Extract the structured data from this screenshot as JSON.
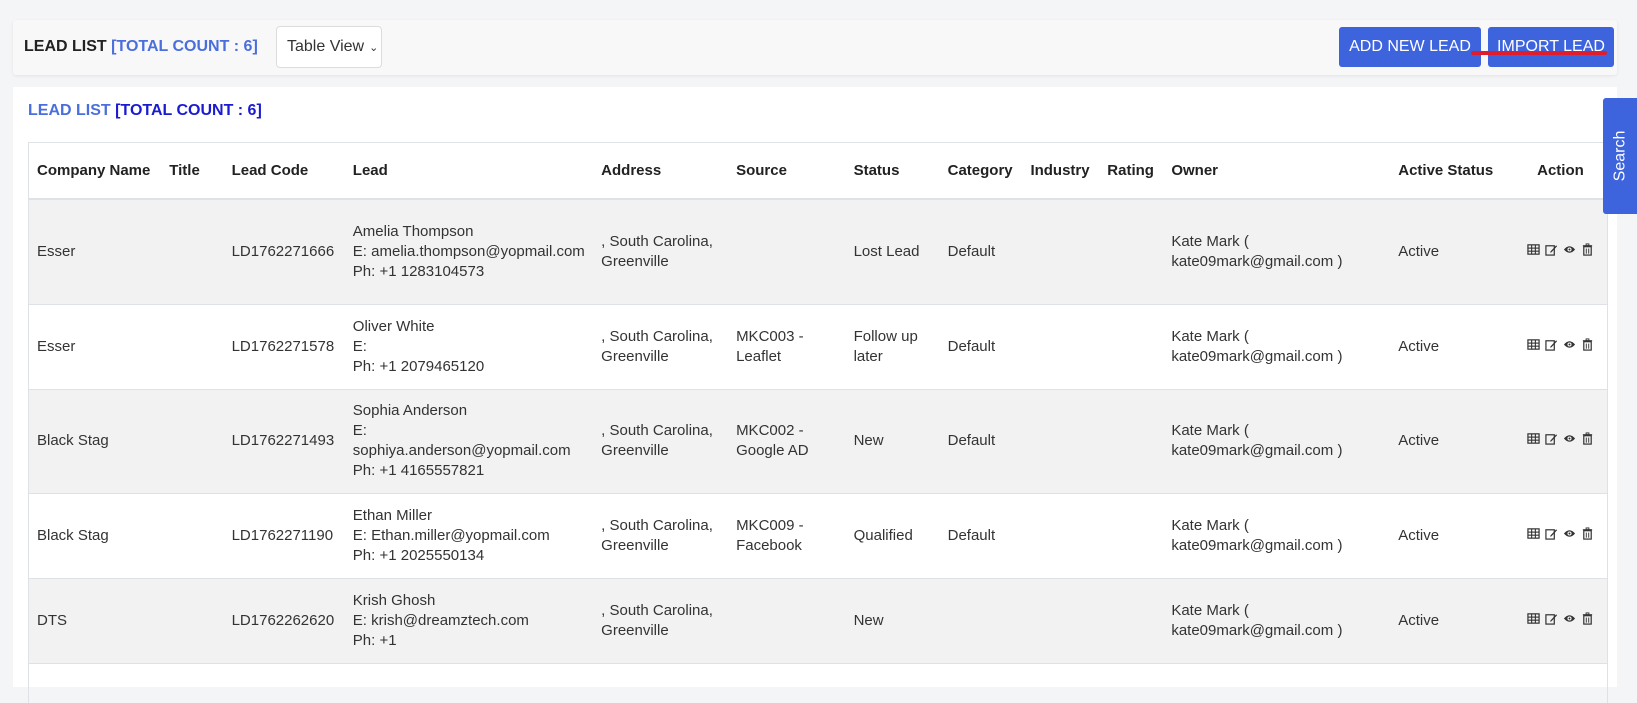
{
  "header": {
    "title": "LEAD LIST",
    "count_label": "[TOTAL COUNT : 6]",
    "view_selector": "Table View",
    "add_button": "ADD NEW LEAD",
    "import_button": "IMPORT LEAD"
  },
  "panel": {
    "title": "LEAD LIST",
    "count_label": "[TOTAL COUNT : 6]"
  },
  "search_tab": "Search",
  "table": {
    "columns": [
      "Company Name",
      "Title",
      "Lead Code",
      "Lead",
      "Address",
      "Source",
      "Status",
      "Category",
      "Industry",
      "Rating",
      "Owner",
      "Active Status",
      "Action"
    ],
    "rows": [
      {
        "company": "Esser",
        "title": "",
        "code": "LD1762271666",
        "lead_name": "Amelia Thompson",
        "lead_email": "E: amelia.thompson@yopmail.com",
        "lead_phone": "Ph: +1 1283104573",
        "address": ", South Carolina, Greenville",
        "source": "",
        "status": "Lost Lead",
        "category": "Default",
        "industry": "",
        "rating": "",
        "owner": "Kate Mark ( kate09mark@gmail.com )",
        "active": "Active"
      },
      {
        "company": "Esser",
        "title": "",
        "code": "LD1762271578",
        "lead_name": "Oliver White",
        "lead_email": "E:",
        "lead_phone": "Ph: +1 2079465120",
        "address": ", South Carolina, Greenville",
        "source": "MKC003 - Leaflet",
        "status": "Follow up later",
        "category": "Default",
        "industry": "",
        "rating": "",
        "owner": "Kate Mark ( kate09mark@gmail.com )",
        "active": "Active"
      },
      {
        "company": "Black Stag",
        "title": "",
        "code": "LD1762271493",
        "lead_name": "Sophia Anderson",
        "lead_email": "E: sophiya.anderson@yopmail.com",
        "lead_phone": "Ph: +1 4165557821",
        "address": ", South Carolina, Greenville",
        "source": "MKC002 - Google AD",
        "status": "New",
        "category": "Default",
        "industry": "",
        "rating": "",
        "owner": "Kate Mark ( kate09mark@gmail.com )",
        "active": "Active"
      },
      {
        "company": "Black Stag",
        "title": "",
        "code": "LD1762271190",
        "lead_name": "Ethan Miller",
        "lead_email": "E: Ethan.miller@yopmail.com",
        "lead_phone": "Ph: +1 2025550134",
        "address": ", South Carolina, Greenville",
        "source": "MKC009 - Facebook",
        "status": "Qualified",
        "category": "Default",
        "industry": "",
        "rating": "",
        "owner": "Kate Mark ( kate09mark@gmail.com )",
        "active": "Active"
      },
      {
        "company": "DTS",
        "title": "",
        "code": "LD1762262620",
        "lead_name": "Krish Ghosh",
        "lead_email": "E: krish@dreamztech.com",
        "lead_phone": "Ph: +1",
        "address": ", South Carolina, Greenville",
        "source": "",
        "status": "New",
        "category": "",
        "industry": "",
        "rating": "",
        "owner": "Kate Mark ( kate09mark@gmail.com )",
        "active": "Active"
      }
    ]
  },
  "icons": {
    "accent": "#3d63dd",
    "row_actions": [
      "table-icon",
      "edit-icon",
      "eye-icon",
      "trash-icon"
    ]
  }
}
